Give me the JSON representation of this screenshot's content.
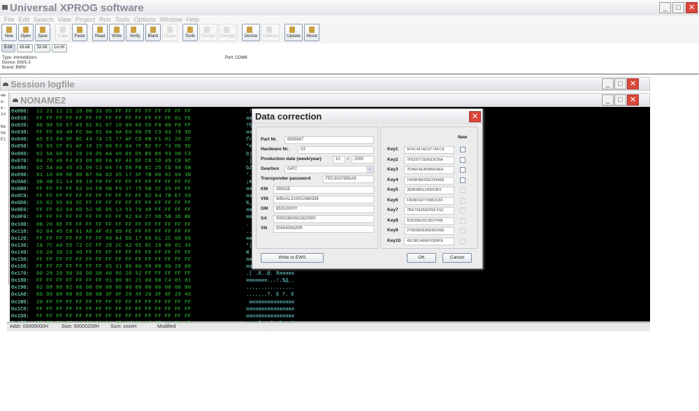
{
  "app": {
    "title": "Universal XPROG software"
  },
  "menu": [
    "File",
    "Edit",
    "Search",
    "View",
    "Project",
    "Run",
    "Tools",
    "Options",
    "Window",
    "Help"
  ],
  "toolbar": [
    {
      "label": "New",
      "enabled": true
    },
    {
      "label": "Open",
      "enabled": true
    },
    {
      "label": "Save",
      "enabled": true
    },
    {
      "label": "Copy",
      "enabled": false
    },
    {
      "label": "Paste",
      "enabled": true
    },
    {
      "label": "Read",
      "enabled": true
    },
    {
      "label": "Write",
      "enabled": true
    },
    {
      "label": "Verify",
      "enabled": true
    },
    {
      "label": "Blank",
      "enabled": true
    },
    {
      "label": "Erase",
      "enabled": false
    },
    {
      "label": "Tools",
      "enabled": true
    },
    {
      "label": "Encrypt",
      "enabled": false
    },
    {
      "label": "Decrypt",
      "enabled": false
    },
    {
      "label": "Device",
      "enabled": true
    },
    {
      "label": "Options",
      "enabled": false
    },
    {
      "label": "Update",
      "enabled": true
    },
    {
      "label": "About",
      "enabled": true
    }
  ],
  "bit_tabs": [
    "8-bit",
    "16-bit",
    "32-bit",
    "Lo-Hi"
  ],
  "info": {
    "type": "Type: Immobilizers",
    "device": "Device: EWS-3",
    "brand": "Brand: BMW",
    "port": "Port: COM6"
  },
  "session": {
    "title": "Session logfile",
    "lines": [
      "we",
      "e-",
      "e-",
      "zo",
      "",
      "Re",
      "Ve",
      "El"
    ]
  },
  "editor": {
    "title": "NONAME2",
    "rows": [
      [
        "0x000:",
        "11 21 11 21 10 08 33 05 FF FF FF FF FF FF FF FF",
        ".!.!..3.яяяяяяяя"
      ],
      [
        "0x010:",
        "FF FF FF FF FF FF FF FF FF FF FF FF FF FF 01 FE",
        "яяяяяяяяяяяяяя.ю"
      ],
      [
        "0x020:",
        "86 90 56 67 03 81 81 07 10 00 06 55 F0 00 F0 FF",
        "†ђVg.ЃЃ....Uр.ря"
      ],
      [
        "0x030:",
        "FF FF 00 40 FC 0A 01 0A 0A E0 00 FE C3 03 78 9D",
        "яя.@ь...а.юГ.xќ"
      ],
      [
        "0x040:",
        "A5 E3 04 5F 8C 43 7A C5 77 AF C8 0B F1 01 26 2F",
        "Ґг._ЊCzЕwЇИ.с.&/"
      ],
      [
        "0x050:",
        "93 65 CF 01 AF 10 15 00 E3 04 7F B2 97 73 D6 5D",
        "“eП.Ї...г..І—sЦ]"
      ],
      [
        "0x060:",
        "62 6A 60 61 26 24 05 AA 46 06 D5 B5 B6 93 00 C3",
        "bj`a&$.ЄF.Хµ¶“.Г"
      ],
      [
        "0x070:",
        "04 7D 46 F4 E3 09 B6 FA EF 44 DF C8 5D 49 C8 9C",
        ".}Fфг.¶ъпDЯИ]IИњ"
      ],
      [
        "0x080:",
        "62 5A A6 45 45 09 C3 04 74 D8 FB 82 25 CD 94 6B",
        "bZ¦EE.Г.tШы‚%Н”k"
      ],
      [
        "0x090:",
        "91 10 88 6E 9D B7 8A D3 35 17 3F 7B 00 02 04 3B",
        "‘.€nќ·ЉУ5.?{...;"
      ],
      [
        "0x0A0:",
        "3B 4B 51 14 09 19 F0 FF FF FF FF FF FF FF FF FF",
        ";KQ...ряяяяяяяяя"
      ],
      [
        "0x0B0:",
        "FF FF FF FF 02 04 F8 0B F9 27 75 5B 2C 65 FF FF",
        "яяяя..ш.щ'u[,eяя"
      ],
      [
        "0x0C0:",
        "FF FF FF FF FF FF FF FF FF FF FF 02 04 7B E7 59",
        "яяяяяяяяяяя..{зY"
      ],
      [
        "0x0D0:",
        "25 82 55 86 5C FF FF FF FF FF FF FF FF FF FF FF",
        "%‚U†\\яяяяяяяяяяя"
      ],
      [
        "0x0E0:",
        "FF FF 02 04 6D 52 9E D5 13 53 70 48 FF FF FF FF",
        "яя..mRћХ.SpHяяяя"
      ],
      [
        "0x0F0:",
        "FF FF FF FF FF FF FF FF FF 02 04 27 9D 5B 3D BE",
        "яяяяяяяяя..'ќ[=ѕ"
      ],
      [
        "0x100:",
        "0B 20 6E FF FF FF FF FF FF FF FF FF FF FF FF FF",
        ". nяяяяяяяяяяяяя"
      ],
      [
        "0x110:",
        "02 04 45 C8 61 A8 AF 03 89 FE FF FF FF FF FF FF",
        "..EИaЁЇ.‰юяяяяяя"
      ],
      [
        "0x120:",
        "FF FF FF FF FF FF FF 00 04 DD 17 06 01 2C 00 00",
        "яяяяяяя..Э...,.."
      ],
      [
        "0x130:",
        "2A 7C A0 55 72 CC FF 20 2C A2 95 0C 10 00 01 34",
        "*| UrМя ,ў•....4"
      ],
      [
        "0x140:",
        "C6 20 30 C6 4D FF FF FF FF FF FF FF FF FF FF FF",
        "Ж 0ЖMяяяяяяяяяяя"
      ],
      [
        "0x150:",
        "FF FF FF FF FF FF FF FF FF FF FF FF FF FF FF FF",
        "яяяяяяяяяяяяяяяя"
      ],
      [
        "0x160:",
        "FF FF FF FF FF FF FF 65 31 00 00 59 00 00 28 00",
        "яяяяяяяe1..Y..(."
      ],
      [
        "0x170:",
        "00 28 20 00 30 00 00 40 06 20 52 FF FF FF FF FF",
        ".( .0..@. Rяяяяя"
      ],
      [
        "0x180:",
        "FF FF FF FF FF FF FF 01 00 0C 21 00 80 C4 01 01",
        "яяяяяяя...!.ЂД.."
      ],
      [
        "0x190:",
        "02 08 00 82 00 00 00 00 00 00 00 00 00 00 00 00",
        "...‚............"
      ],
      [
        "0x1A0:",
        "00 00 00 00 00 00 00 3F 0F 20 45 20 3F 0F 20 45",
        ".......?. E ?. E"
      ],
      [
        "0x1B0:",
        "20 FF FF FF FF FF FF FF FF FF FF FF FF FF FF FF",
        " яяяяяяяяяяяяяяя"
      ],
      [
        "0x1C0:",
        "FF FF FF FF FF FF FF FF FF FF FF FF FF FF FF FF",
        "яяяяяяяяяяяяяяяя"
      ],
      [
        "0x1D0:",
        "FF FF FF FF FF FF FF FF FF FF FF FF FF FF FF FF",
        "яяяяяяяяяяяяяяяя"
      ],
      [
        "0x1E0:",
        "FF FF FF FF 24 03 00 00 DD 17 06 8E FE 1A 71 4D",
        "яяяя$...Э..Ћю.qM"
      ],
      [
        "0x1F0:",
        "C1 E7 34 12 4C 4E 24 00 FF FF FF FF FF FF FF FF",
        "Бз4.LN$.яяяяяяяя"
      ]
    ]
  },
  "status": {
    "addr": "Addr: 00000000H",
    "size": "Size: 00000200H",
    "sum": "Sum: xxxxH",
    "state": "Modified"
  },
  "dialog": {
    "title": "Data correction",
    "part_label": "Part Nr.",
    "part": "6905667",
    "hw_label": "Hardware Nr.",
    "hw": "03",
    "date_label": "Production date (week/year)",
    "week": "10",
    "slash": "/",
    "year": "2000",
    "gearbox_label": "Gearbox",
    "gearbox": "0xFC",
    "tp_label": "Transponder password",
    "tp": "FEC303789DA5",
    "fields": [
      {
        "label": "KM",
        "value": "399325"
      },
      {
        "label": "VIN",
        "value": "WBAAL31000J368336"
      },
      {
        "label": "GM",
        "value": "65310000Y"
      },
      {
        "label": "SA",
        "value": "00002800002820000"
      },
      {
        "label": "VN",
        "value": "0000400620R"
      }
    ],
    "new_label": "New",
    "keys": [
      {
        "label": "Key1",
        "value": "5F8C437AC577AFC8",
        "new": false,
        "enabled": true
      },
      {
        "label": "Key2",
        "value": "7F829773D65D626A",
        "new": false,
        "enabled": true
      },
      {
        "label": "Key3",
        "value": "7D46F4E309B6FAEF",
        "new": false,
        "enabled": true
      },
      {
        "label": "Key4",
        "value": "74D8FB8225CD946B",
        "new": false,
        "enabled": true
      },
      {
        "label": "Key5",
        "value": "383B4851140919F0",
        "new": true,
        "enabled": false
      },
      {
        "label": "Key6",
        "value": "F80BF927755B2C65",
        "new": true,
        "enabled": false
      },
      {
        "label": "Key7",
        "value": "7BE7592582558 6SC",
        "new": true,
        "enabled": false
      },
      {
        "label": "Key8",
        "value": "6D529ED513537048",
        "new": true,
        "enabled": false
      },
      {
        "label": "Key9",
        "value": "279D5B3DBE0B206E",
        "new": true,
        "enabled": false
      },
      {
        "label": "Key10",
        "value": "45C861A8AF0389FE",
        "new": true,
        "enabled": false
      }
    ],
    "write_btn": "Write to EWS",
    "ok_btn": "OK",
    "cancel_btn": "Cancel"
  }
}
